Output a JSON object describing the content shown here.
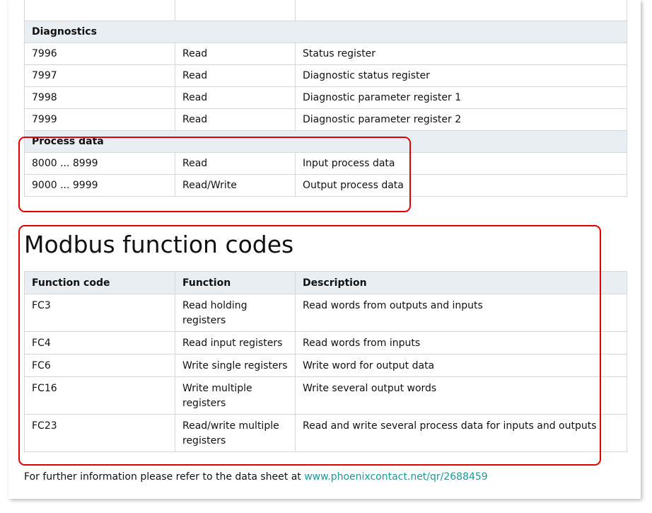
{
  "register_table": {
    "diagnostics_title": "Diagnostics",
    "diagnostics_rows": [
      {
        "address": "7996",
        "access": "Read",
        "description": "Status register"
      },
      {
        "address": "7997",
        "access": "Read",
        "description": "Diagnostic status register"
      },
      {
        "address": "7998",
        "access": "Read",
        "description": "Diagnostic parameter register 1"
      },
      {
        "address": "7999",
        "access": "Read",
        "description": "Diagnostic parameter register 2"
      }
    ],
    "process_title": "Process data",
    "process_rows": [
      {
        "address": "8000 ... 8999",
        "access": "Read",
        "description": "Input process data"
      },
      {
        "address": "9000 ... 9999",
        "access": "Read/Write",
        "description": "Output process data"
      }
    ]
  },
  "modbus": {
    "heading": "Modbus function codes",
    "headers": {
      "code": "Function code",
      "function": "Function",
      "description": "Description"
    },
    "rows": [
      {
        "code": "FC3",
        "function": "Read holding registers",
        "description": "Read words from outputs and inputs"
      },
      {
        "code": "FC4",
        "function": "Read input registers",
        "description": "Read words from inputs"
      },
      {
        "code": "FC6",
        "function": "Write single registers",
        "description": "Write word for output data"
      },
      {
        "code": "FC16",
        "function": "Write multiple registers",
        "description": "Write several output words"
      },
      {
        "code": "FC23",
        "function": "Read/write multiple registers",
        "description": "Read and write several process data for inputs and outputs"
      }
    ]
  },
  "footer": {
    "text": "For further information please refer to the data sheet at ",
    "link": "www.phoenixcontact.net/qr/2688459"
  },
  "colors": {
    "highlight": "#e00000",
    "link": "#1a9a9a",
    "section_bg": "#e9eef2",
    "border": "#d2d8de"
  }
}
